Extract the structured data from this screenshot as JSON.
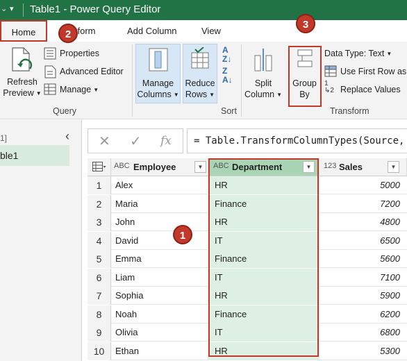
{
  "window": {
    "title": "Table1 - Power Query Editor"
  },
  "tabs": [
    {
      "label": "Home"
    },
    {
      "label": "sform"
    },
    {
      "label": "Add Column"
    },
    {
      "label": "View"
    }
  ],
  "ribbon": {
    "refresh_preview": {
      "line1": "Refresh",
      "line2": "Preview"
    },
    "properties": "Properties",
    "advanced_editor": "Advanced Editor",
    "manage": "Manage",
    "query_group": "Query",
    "manage_columns": {
      "line1": "Manage",
      "line2": "Columns"
    },
    "reduce_rows": {
      "line1": "Reduce",
      "line2": "Rows"
    },
    "sort_group": "Sort",
    "split_column": {
      "line1": "Split",
      "line2": "Column"
    },
    "group_by": {
      "line1": "Group",
      "line2": "By"
    },
    "data_type": "Data Type: Text",
    "use_first_row": "Use First Row as",
    "replace_values": "Replace Values",
    "transform_group": "Transform"
  },
  "left_pane": {
    "bracket_text": "1]",
    "query_item": "ble1"
  },
  "formula_bar": {
    "formula": "= Table.TransformColumnTypes(Source,"
  },
  "table": {
    "columns": [
      {
        "type": "ABC",
        "name": "Employee"
      },
      {
        "type": "ABC",
        "name": "Department"
      },
      {
        "type": "123",
        "name": "Sales"
      }
    ],
    "rows": [
      {
        "idx": "1",
        "employee": "Alex",
        "department": "HR",
        "sales": "5000"
      },
      {
        "idx": "2",
        "employee": "Maria",
        "department": "Finance",
        "sales": "7200"
      },
      {
        "idx": "3",
        "employee": "John",
        "department": "HR",
        "sales": "4800"
      },
      {
        "idx": "4",
        "employee": "David",
        "department": "IT",
        "sales": "6500"
      },
      {
        "idx": "5",
        "employee": "Emma",
        "department": "Finance",
        "sales": "5600"
      },
      {
        "idx": "6",
        "employee": "Liam",
        "department": "IT",
        "sales": "7100"
      },
      {
        "idx": "7",
        "employee": "Sophia",
        "department": "HR",
        "sales": "5900"
      },
      {
        "idx": "8",
        "employee": "Noah",
        "department": "Finance",
        "sales": "6200"
      },
      {
        "idx": "9",
        "employee": "Olivia",
        "department": "IT",
        "sales": "6800"
      },
      {
        "idx": "10",
        "employee": "Ethan",
        "department": "HR",
        "sales": "5300"
      }
    ]
  },
  "markers": [
    "1",
    "2",
    "3"
  ],
  "colors": {
    "title_bar": "#217346",
    "highlight_red": "#c0392b",
    "selected_column": "#ddf0e3"
  }
}
